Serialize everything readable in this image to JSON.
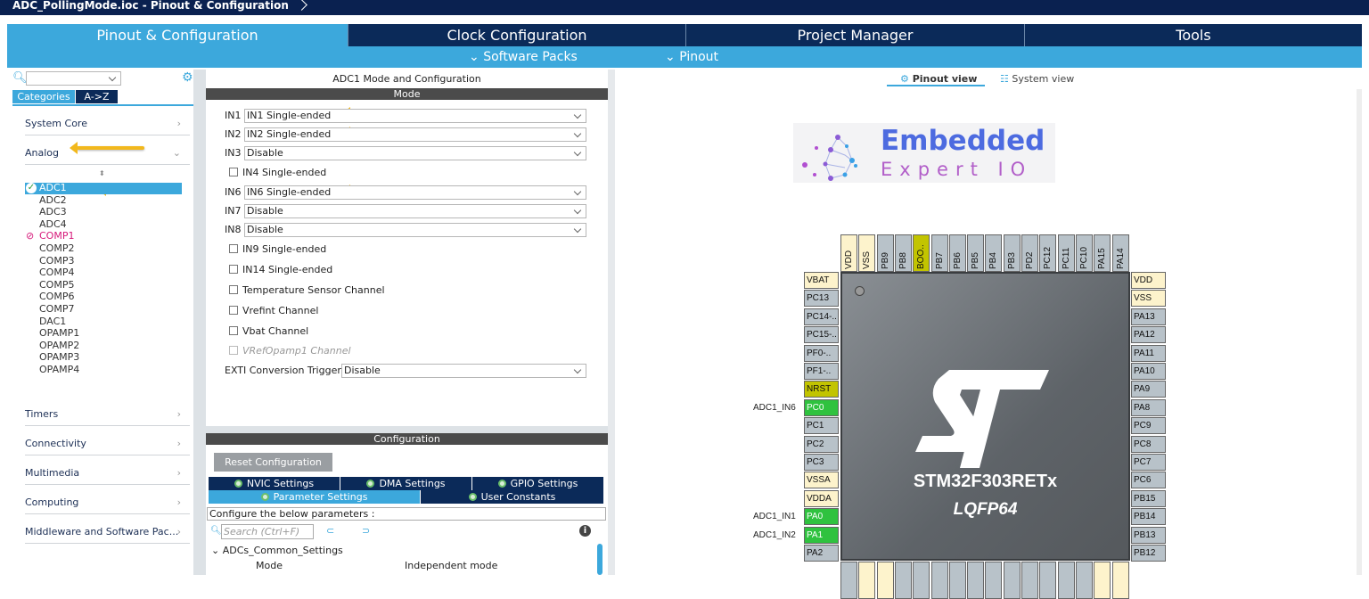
{
  "window": {
    "title": "ADC_PollingMode.ioc - Pinout & Configuration"
  },
  "main_tabs": [
    {
      "label": "Pinout & Configuration",
      "active": true
    },
    {
      "label": "Clock Configuration"
    },
    {
      "label": "Project Manager"
    },
    {
      "label": "Tools"
    }
  ],
  "subbar": {
    "software_packs": "Software Packs",
    "pinout": "Pinout"
  },
  "left": {
    "search_placeholder": "",
    "tab_categories": "Categories",
    "tab_az": "A->Z",
    "categories": [
      "System Core",
      "Analog",
      "Timers",
      "Connectivity",
      "Multimedia",
      "Computing",
      "Middleware and Software Pac..."
    ],
    "analog_items": [
      {
        "label": "ADC1",
        "status": "ok",
        "selected": true
      },
      {
        "label": "ADC2"
      },
      {
        "label": "ADC3"
      },
      {
        "label": "ADC4"
      },
      {
        "label": "COMP1",
        "status": "conflict"
      },
      {
        "label": "COMP2"
      },
      {
        "label": "COMP3"
      },
      {
        "label": "COMP4"
      },
      {
        "label": "COMP5"
      },
      {
        "label": "COMP6"
      },
      {
        "label": "COMP7"
      },
      {
        "label": "DAC1"
      },
      {
        "label": "OPAMP1"
      },
      {
        "label": "OPAMP2"
      },
      {
        "label": "OPAMP3"
      },
      {
        "label": "OPAMP4"
      }
    ]
  },
  "mode": {
    "header": "ADC1 Mode and Configuration",
    "bar": "Mode",
    "rows": [
      {
        "type": "select",
        "label": "IN1",
        "value": "IN1 Single-ended"
      },
      {
        "type": "select",
        "label": "IN2",
        "value": "IN2 Single-ended"
      },
      {
        "type": "select",
        "label": "IN3",
        "value": "Disable"
      },
      {
        "type": "check",
        "label": "IN4 Single-ended",
        "checked": false
      },
      {
        "type": "select",
        "label": "IN6",
        "value": "IN6 Single-ended"
      },
      {
        "type": "select",
        "label": "IN7",
        "value": "Disable"
      },
      {
        "type": "select",
        "label": "IN8",
        "value": "Disable"
      },
      {
        "type": "check",
        "label": "IN9 Single-ended",
        "checked": false
      },
      {
        "type": "check",
        "label": "IN14 Single-ended",
        "checked": false
      },
      {
        "type": "check",
        "label": "Temperature Sensor Channel",
        "checked": false
      },
      {
        "type": "check",
        "label": "Vrefint Channel",
        "checked": false
      },
      {
        "type": "check",
        "label": "Vbat Channel",
        "checked": false
      },
      {
        "type": "check",
        "label": "VRefOpamp1 Channel",
        "checked": false,
        "disabled": true
      },
      {
        "type": "select",
        "label": "EXTI Conversion Trigger",
        "value": "Disable"
      }
    ]
  },
  "config": {
    "bar": "Configuration",
    "reset": "Reset Configuration",
    "tabs_row1": [
      "NVIC Settings",
      "DMA Settings",
      "GPIO Settings"
    ],
    "tabs_row2": [
      "Parameter Settings",
      "User Constants"
    ],
    "hint": "Configure the below parameters :",
    "search_placeholder": "Search (Ctrl+F)",
    "group": "ADCs_Common_Settings",
    "param_name": "Mode",
    "param_value": "Independent mode"
  },
  "view": {
    "pinout": "Pinout view",
    "system": "System view"
  },
  "logo": {
    "line1": "Embedded",
    "line2": "Expert IO"
  },
  "chip": {
    "name": "STM32F303RETx",
    "package": "LQFP64"
  },
  "colors": {
    "navy": "#0b2a59",
    "accent": "#3ca8dc",
    "gpio_active": "#2fc23f",
    "power": "#fdf3cc",
    "reset": "#c2c400",
    "pin_default": "#b8c2c9"
  },
  "pins": {
    "top": [
      {
        "n": "VDD",
        "t": "power"
      },
      {
        "n": "VSS",
        "t": "power"
      },
      {
        "n": "PB9"
      },
      {
        "n": "PB8"
      },
      {
        "n": "BOO..",
        "t": "reset"
      },
      {
        "n": "PB7"
      },
      {
        "n": "PB6"
      },
      {
        "n": "PB5"
      },
      {
        "n": "PB4"
      },
      {
        "n": "PB3"
      },
      {
        "n": "PD2"
      },
      {
        "n": "PC12"
      },
      {
        "n": "PC11"
      },
      {
        "n": "PC10"
      },
      {
        "n": "PA15"
      },
      {
        "n": "PA14"
      }
    ],
    "left": [
      {
        "n": "VBAT",
        "t": "power"
      },
      {
        "n": "PC13"
      },
      {
        "n": "PC14-.."
      },
      {
        "n": "PC15-.."
      },
      {
        "n": "PF0-.."
      },
      {
        "n": "PF1-.."
      },
      {
        "n": "NRST",
        "t": "reset"
      },
      {
        "n": "PC0",
        "t": "gpio",
        "signal": "ADC1_IN6"
      },
      {
        "n": "PC1"
      },
      {
        "n": "PC2"
      },
      {
        "n": "PC3"
      },
      {
        "n": "VSSA",
        "t": "power"
      },
      {
        "n": "VDDA",
        "t": "power"
      },
      {
        "n": "PA0",
        "t": "gpio",
        "signal": "ADC1_IN1"
      },
      {
        "n": "PA1",
        "t": "gpio",
        "signal": "ADC1_IN2"
      },
      {
        "n": "PA2"
      }
    ],
    "right": [
      {
        "n": "VDD",
        "t": "power"
      },
      {
        "n": "VSS",
        "t": "power"
      },
      {
        "n": "PA13"
      },
      {
        "n": "PA12"
      },
      {
        "n": "PA11"
      },
      {
        "n": "PA10"
      },
      {
        "n": "PA9"
      },
      {
        "n": "PA8"
      },
      {
        "n": "PC9"
      },
      {
        "n": "PC8"
      },
      {
        "n": "PC7"
      },
      {
        "n": "PC6"
      },
      {
        "n": "PB15"
      },
      {
        "n": "PB14"
      },
      {
        "n": "PB13"
      },
      {
        "n": "PB12"
      }
    ],
    "bottom_types": [
      "default",
      "power",
      "power",
      "default",
      "default",
      "default",
      "default",
      "default",
      "default",
      "default",
      "default",
      "default",
      "default",
      "default",
      "power",
      "power"
    ]
  }
}
